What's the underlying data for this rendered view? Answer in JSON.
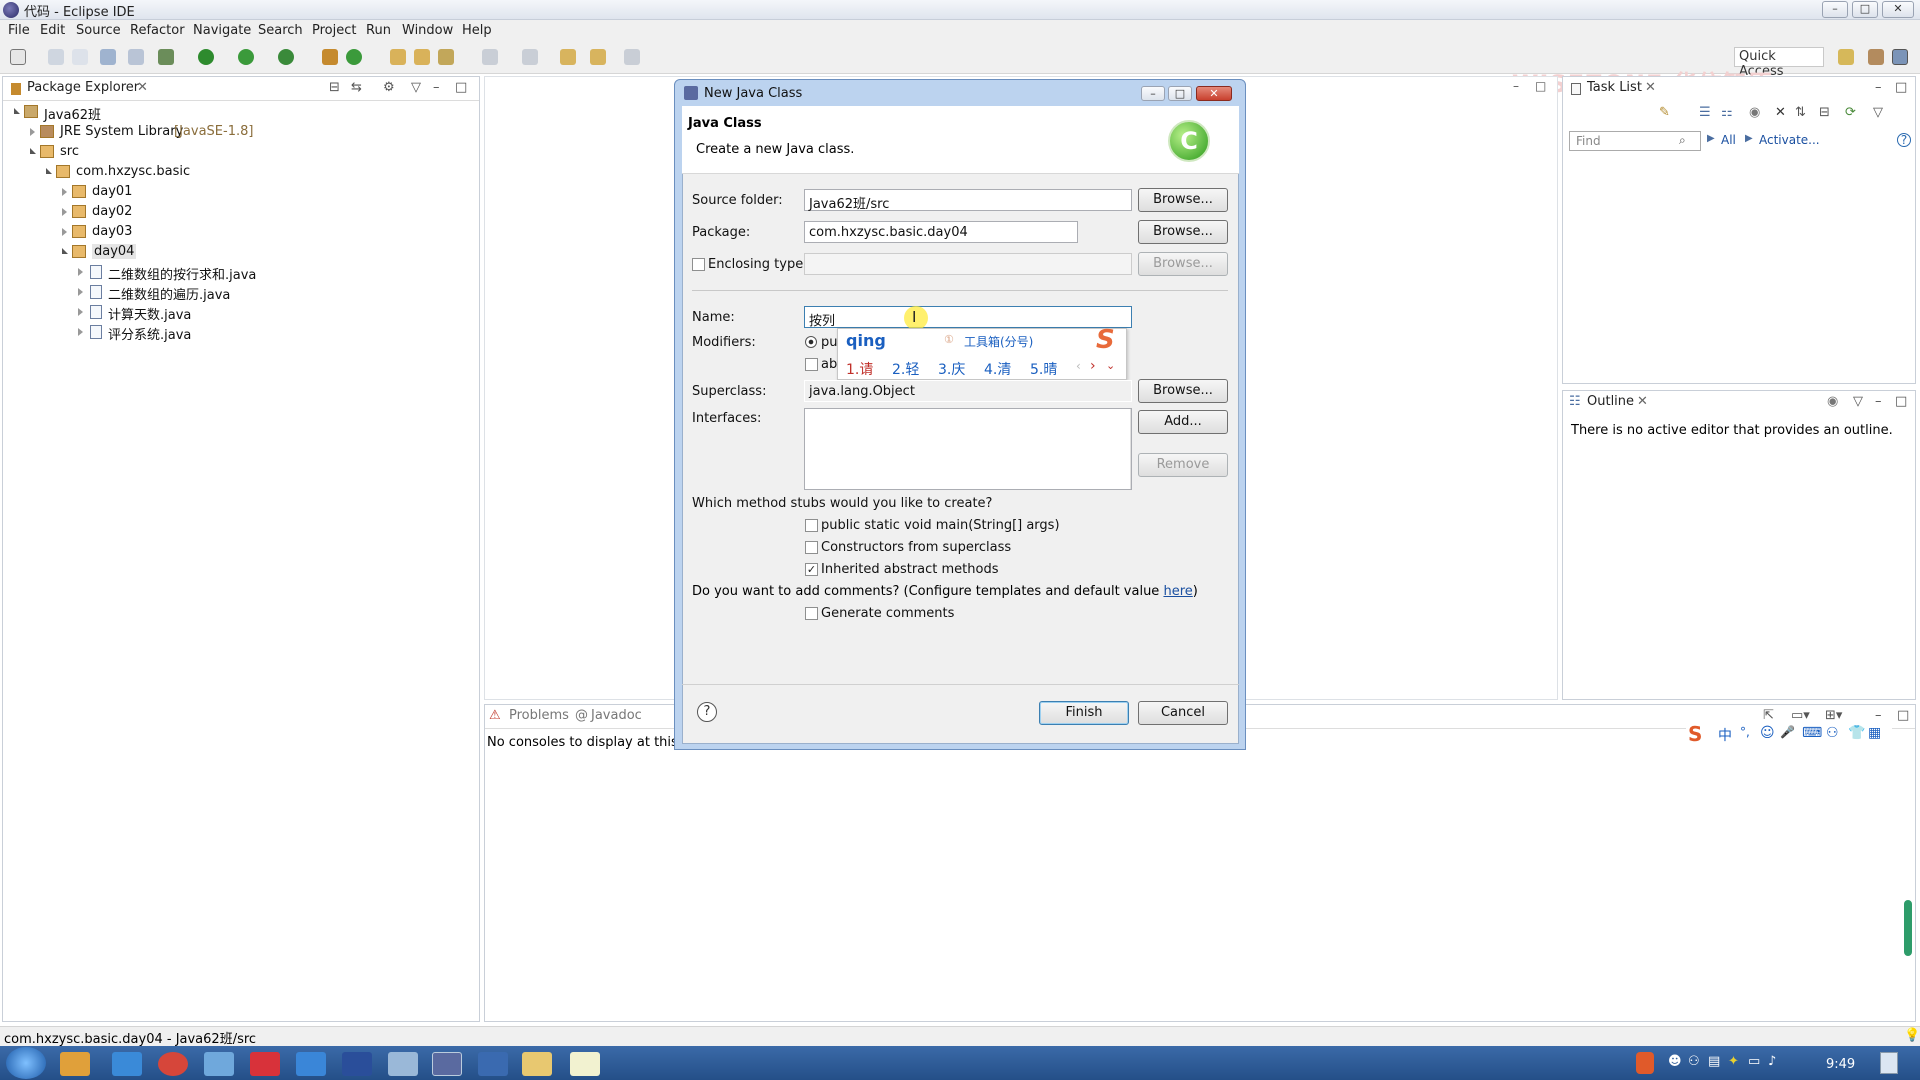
{
  "window": {
    "title": "代码 - Eclipse IDE",
    "min": "–",
    "max": "□",
    "close": "✕"
  },
  "menu": [
    "File",
    "Edit",
    "Source",
    "Refactor",
    "Navigate",
    "Search",
    "Project",
    "Run",
    "Window",
    "Help"
  ],
  "toolbar": {
    "quick_access": "Quick Access"
  },
  "watermark": "WISEZONE 华信智原",
  "package_explorer": {
    "title": "Package Explorer",
    "project": "Java62班",
    "jre": "JRE System Library",
    "jre_version": "[JavaSE-1.8]",
    "src": "src",
    "package": "com.hxzysc.basic",
    "days": [
      "day01",
      "day02",
      "day03",
      "day04"
    ],
    "files": [
      "二维数组的按行求和.java",
      "二维数组的遍历.java",
      "计算天数.java",
      "评分系统.java"
    ]
  },
  "task_list": {
    "title": "Task List",
    "find_placeholder": "Find",
    "all": "All",
    "activate": "Activate..."
  },
  "outline": {
    "title": "Outline",
    "message": "There is no active editor that provides an outline."
  },
  "bottom_panel": {
    "tab_problems": "Problems",
    "tab_javadoc": "Javadoc",
    "message": "No consoles to display at this ti"
  },
  "status": "com.hxzysc.basic.day04 - Java62班/src",
  "clock": "9:49",
  "dialog": {
    "title": "New Java Class",
    "header": "Java Class",
    "subheader": "Create a new Java class.",
    "source_folder_label": "Source folder:",
    "source_folder": "Java62班/src",
    "package_label": "Package:",
    "package": "com.hxzysc.basic.day04",
    "enclosing_label": "Enclosing type:",
    "name_label": "Name:",
    "name_value": "按列",
    "modifiers_label": "Modifiers:",
    "mod_public": "pu",
    "mod_abstract": "ab",
    "superclass_label": "Superclass:",
    "superclass": "java.lang.Object",
    "interfaces_label": "Interfaces:",
    "browse": "Browse...",
    "add": "Add...",
    "remove": "Remove",
    "stubs_question": "Which method stubs would you like to create?",
    "stub_main": "public static void main(String[] args)",
    "stub_ctor": "Constructors from superclass",
    "stub_inherited": "Inherited abstract methods",
    "comments_question": "Do you want to add comments? (Configure templates and default value",
    "here": "here",
    "comments_close": ")",
    "generate_comments": "Generate comments",
    "finish": "Finish",
    "cancel": "Cancel",
    "help": "?"
  },
  "ime": {
    "input": "qing",
    "hint": "工具箱(分号)",
    "candidates": [
      "1.请",
      "2.轻",
      "3.庆",
      "4.清",
      "5.晴"
    ],
    "logo": "S"
  },
  "ime_bar": [
    "中",
    "°,",
    "☺",
    "🎤",
    "⌨"
  ]
}
